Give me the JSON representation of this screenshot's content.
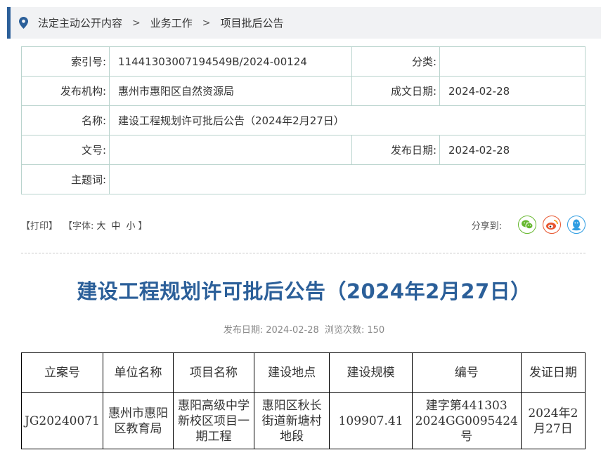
{
  "breadcrumb": {
    "items": [
      "法定主动公开内容",
      "业务工作",
      "项目批后公告"
    ],
    "separator": ">"
  },
  "info": {
    "index_label": "索引号:",
    "index_value": "11441303007194549B/2024-00124",
    "category_label": "分类:",
    "category_value": "",
    "publisher_label": "发布机构:",
    "publisher_value": "惠州市惠阳区自然资源局",
    "created_label": "成文日期:",
    "created_value": "2024-02-28",
    "name_label": "名称:",
    "name_value": "建设工程规划许可批后公告（2024年2月27日）",
    "docno_label": "文号:",
    "docno_value": "",
    "pubdate_label": "发布日期:",
    "pubdate_value": "2024-02-28",
    "keywords_label": "主题词:",
    "keywords_value": ""
  },
  "toolbar": {
    "print": "【打印】",
    "font_prefix": "【字体:",
    "font_large": "大",
    "font_medium": "中",
    "font_small": "小",
    "font_suffix": "】",
    "share_label": "分享到:"
  },
  "article": {
    "title": "建设工程规划许可批后公告（2024年2月27日）",
    "pubdate_label": "发布日期:",
    "pubdate_value": "2024-02-28",
    "views_label": "浏览次数:",
    "views_value": "150"
  },
  "table": {
    "headers": [
      "立案号",
      "单位名称",
      "项目名称",
      "建设地点",
      "建设规模",
      "编号",
      "发证日期"
    ],
    "rows": [
      [
        "JG20240071",
        "惠州市惠阳区教育局",
        "惠阳高级中学新校区项目一期工程",
        "惠阳区秋长街道新塘村地段",
        "109907.41",
        "建字第441303 2024GG0095424号",
        "2024年2月27日"
      ]
    ]
  },
  "colors": {
    "accent": "#2b5f99",
    "border": "#b9d3cd",
    "wechat": "#68b830",
    "weibo": "#e8562f",
    "qq": "#2f9de2"
  }
}
